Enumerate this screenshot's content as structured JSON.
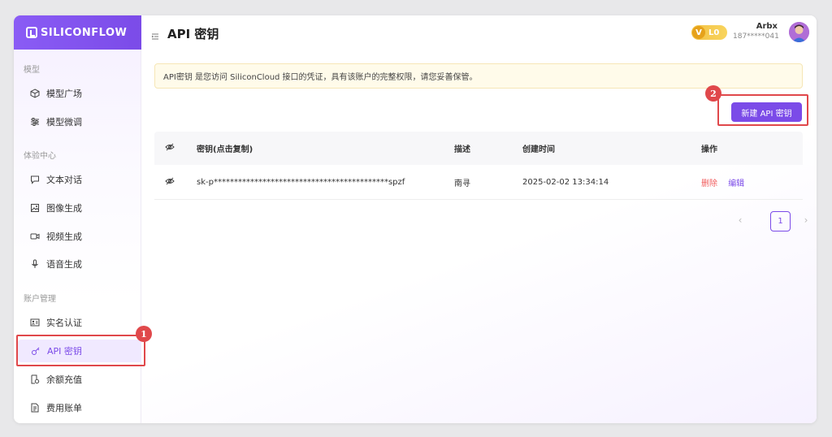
{
  "app": {
    "logo_text": "SILICONFLOW"
  },
  "sidebar": {
    "sections": [
      {
        "label": "模型"
      },
      {
        "label": "体验中心"
      },
      {
        "label": "账户管理"
      }
    ],
    "items": [
      {
        "label": "模型广场",
        "icon": "cube-icon"
      },
      {
        "label": "模型微调",
        "icon": "sliders-icon"
      },
      {
        "label": "文本对话",
        "icon": "chat-icon"
      },
      {
        "label": "图像生成",
        "icon": "image-icon"
      },
      {
        "label": "视频生成",
        "icon": "video-icon"
      },
      {
        "label": "语音生成",
        "icon": "mic-icon"
      },
      {
        "label": "实名认证",
        "icon": "id-card-icon"
      },
      {
        "label": "API 密钥",
        "icon": "key-icon",
        "active": true
      },
      {
        "label": "余额充值",
        "icon": "recharge-icon"
      },
      {
        "label": "费用账单",
        "icon": "bill-icon"
      }
    ]
  },
  "header": {
    "title": "API 密钥",
    "vip_letter": "V",
    "vip_level": "L0",
    "user_name": "Arbx",
    "user_phone": "187*****041"
  },
  "notice": {
    "text": "API密钥 是您访问 SiliconCloud 接口的凭证，具有该账户的完整权限，请您妥善保管。"
  },
  "actions": {
    "new_key_label": "新建 API 密钥"
  },
  "table": {
    "columns": [
      "密钥(点击复制)",
      "描述",
      "创建时间",
      "操作"
    ],
    "rows": [
      {
        "key": "sk-p*******************************************spzf",
        "desc": "南寻",
        "created": "2025-02-02 13:34:14",
        "delete_label": "删除",
        "edit_label": "编辑"
      }
    ]
  },
  "pagination": {
    "prev": "‹",
    "current": "1",
    "next": "›"
  },
  "annotations": [
    {
      "number": "1"
    },
    {
      "number": "2"
    }
  ],
  "colors": {
    "accent": "#7b4be8",
    "danger": "#f15c5c",
    "annotation": "#e0484b",
    "notice_bg": "#fffbea"
  }
}
